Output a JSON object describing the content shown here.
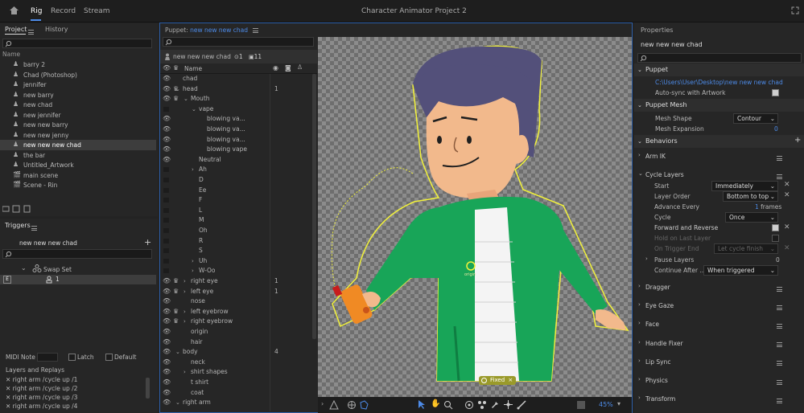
{
  "app": {
    "title": "Character Animator Project 2",
    "tabs": [
      "Rig",
      "Record",
      "Stream"
    ],
    "active_tab": "Rig"
  },
  "project": {
    "tabs": [
      "Project",
      "History"
    ],
    "column": "Name",
    "items": [
      {
        "label": "barry 2",
        "icon": "puppet-icon"
      },
      {
        "label": "Chad (Photoshop)",
        "icon": "puppet-icon"
      },
      {
        "label": "jennifer",
        "icon": "puppet-icon"
      },
      {
        "label": "new barry",
        "icon": "puppet-icon"
      },
      {
        "label": "new chad",
        "icon": "puppet-icon"
      },
      {
        "label": "new jennifer",
        "icon": "puppet-icon"
      },
      {
        "label": "new new barry",
        "icon": "puppet-icon"
      },
      {
        "label": "new new jenny",
        "icon": "puppet-icon"
      },
      {
        "label": "new new new chad",
        "icon": "puppet-icon",
        "selected": true
      },
      {
        "label": "the bar",
        "icon": "puppet-icon"
      },
      {
        "label": "Untitled_Artwork",
        "icon": "puppet-icon"
      },
      {
        "label": "main scene",
        "icon": "scene-icon"
      },
      {
        "label": "Scene - Rin",
        "icon": "scene-icon"
      }
    ]
  },
  "triggers": {
    "title": "Triggers",
    "puppet": "new new new chad",
    "swap_set": "Swap Set",
    "swap_item": "1",
    "midi_label": "MIDI Note",
    "latch": "Latch",
    "default": "Default",
    "layers_title": "Layers and Replays",
    "replays": [
      "right arm /cycle up /1",
      "right arm /cycle up /2",
      "right arm /cycle up /3",
      "right arm /cycle up /4"
    ]
  },
  "puppet_panel": {
    "header_prefix": "Puppet:",
    "header_name": "new new new chad",
    "puppet_name": "new new new chad",
    "count_a": "1",
    "count_b": "11",
    "column": "Name",
    "layers": [
      {
        "name": "chad",
        "indent": 1,
        "eye": true,
        "crown": false,
        "num": ""
      },
      {
        "name": "head",
        "indent": 1,
        "eye": true,
        "crown": true,
        "num": "1",
        "expand": "v"
      },
      {
        "name": "Mouth",
        "indent": 2,
        "eye": true,
        "crown": true,
        "num": "",
        "expand": "v"
      },
      {
        "name": "vape",
        "indent": 3,
        "eye": false,
        "crown": false,
        "num": "",
        "expand": "v"
      },
      {
        "name": "blowing va...",
        "indent": 4,
        "eye": true,
        "crown": false,
        "num": ""
      },
      {
        "name": "blowing va...",
        "indent": 4,
        "eye": true,
        "crown": false,
        "num": ""
      },
      {
        "name": "blowing va...",
        "indent": 4,
        "eye": true,
        "crown": false,
        "num": ""
      },
      {
        "name": "blowing vape",
        "indent": 4,
        "eye": true,
        "crown": false,
        "num": ""
      },
      {
        "name": "Neutral",
        "indent": 3,
        "eye": true,
        "crown": false,
        "num": ""
      },
      {
        "name": "Ah",
        "indent": 3,
        "eye": false,
        "crown": false,
        "num": "",
        "expand": ">"
      },
      {
        "name": "D",
        "indent": 3,
        "eye": false,
        "crown": false,
        "num": ""
      },
      {
        "name": "Ee",
        "indent": 3,
        "eye": false,
        "crown": false,
        "num": ""
      },
      {
        "name": "F",
        "indent": 3,
        "eye": false,
        "crown": false,
        "num": ""
      },
      {
        "name": "L",
        "indent": 3,
        "eye": false,
        "crown": false,
        "num": ""
      },
      {
        "name": "M",
        "indent": 3,
        "eye": false,
        "crown": false,
        "num": ""
      },
      {
        "name": "Oh",
        "indent": 3,
        "eye": false,
        "crown": false,
        "num": ""
      },
      {
        "name": "R",
        "indent": 3,
        "eye": false,
        "crown": false,
        "num": ""
      },
      {
        "name": "S",
        "indent": 3,
        "eye": false,
        "crown": false,
        "num": ""
      },
      {
        "name": "Uh",
        "indent": 3,
        "eye": false,
        "crown": false,
        "num": "",
        "expand": ">"
      },
      {
        "name": "W-Oo",
        "indent": 3,
        "eye": false,
        "crown": false,
        "num": "",
        "expand": ">"
      },
      {
        "name": "right eye",
        "indent": 2,
        "eye": true,
        "crown": true,
        "num": "1",
        "expand": ">"
      },
      {
        "name": "left eye",
        "indent": 2,
        "eye": true,
        "crown": true,
        "num": "1",
        "expand": ">"
      },
      {
        "name": "nose",
        "indent": 2,
        "eye": true,
        "crown": false,
        "num": ""
      },
      {
        "name": "left eyebrow",
        "indent": 2,
        "eye": true,
        "crown": true,
        "num": "",
        "expand": ">"
      },
      {
        "name": "right eyebrow",
        "indent": 2,
        "eye": true,
        "crown": true,
        "num": "",
        "expand": ">"
      },
      {
        "name": "origin",
        "indent": 2,
        "eye": true,
        "crown": false,
        "num": ""
      },
      {
        "name": "hair",
        "indent": 2,
        "eye": true,
        "crown": false,
        "num": ""
      },
      {
        "name": "body",
        "indent": 1,
        "eye": true,
        "crown": false,
        "num": "4",
        "expand": "v"
      },
      {
        "name": "neck",
        "indent": 2,
        "eye": true,
        "crown": false,
        "num": ""
      },
      {
        "name": "shirt shapes",
        "indent": 2,
        "eye": true,
        "crown": false,
        "num": "",
        "expand": ">"
      },
      {
        "name": "t shirt",
        "indent": 2,
        "eye": true,
        "crown": false,
        "num": ""
      },
      {
        "name": "coat",
        "indent": 2,
        "eye": true,
        "crown": false,
        "num": ""
      },
      {
        "name": "right arm",
        "indent": 1,
        "eye": true,
        "crown": false,
        "num": "",
        "expand": "v"
      }
    ]
  },
  "canvas": {
    "origin_label": "origin",
    "fixed_label": "Fixed",
    "zoom": "45%"
  },
  "properties": {
    "title": "Properties",
    "name": "new new new chad",
    "puppet_section": "Puppet",
    "path": "C:\\Users\\User\\Desktop\\new new new chad",
    "auto_sync": "Auto-sync with Artwork",
    "mesh_section": "Puppet Mesh",
    "mesh_shape_label": "Mesh Shape",
    "mesh_shape_value": "Contour",
    "mesh_expansion_label": "Mesh Expansion",
    "mesh_expansion_value": "0",
    "behaviors_section": "Behaviors",
    "behaviors": [
      "Arm IK",
      "Cycle Layers",
      "Dragger",
      "Eye Gaze",
      "Face",
      "Handle Fixer",
      "Lip Sync",
      "Physics",
      "Transform"
    ],
    "cycle": {
      "start_label": "Start",
      "start_value": "Immediately",
      "order_label": "Layer Order",
      "order_value": "Bottom to top",
      "advance_label": "Advance Every",
      "advance_value": "1",
      "advance_unit": "frames",
      "cycle_label": "Cycle",
      "cycle_value": "Once",
      "fr_label": "Forward and Reverse",
      "hold_label": "Hold on Last Layer",
      "trigger_end_label": "On Trigger End",
      "trigger_end_value": "Let cycle finish",
      "pause_label": "Pause Layers",
      "pause_value": "0",
      "continue_label": "Continue After ...",
      "continue_value": "When triggered"
    }
  }
}
